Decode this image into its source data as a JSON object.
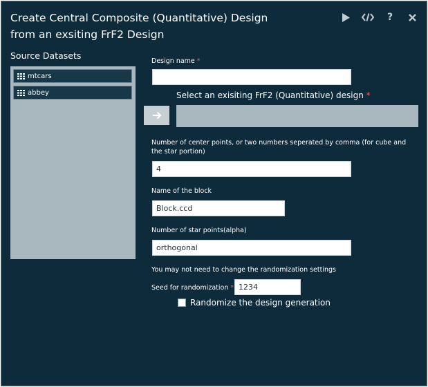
{
  "dialog": {
    "title_line1": "Create Central Composite (Quantitative) Design",
    "title_line2": "from an exsiting FrF2 Design",
    "toolbar": [
      "run-icon",
      "code-icon",
      "help-icon",
      "close-icon"
    ]
  },
  "source": {
    "label": "Source Datasets",
    "datasets": [
      {
        "name": "mtcars"
      },
      {
        "name": "abbey"
      }
    ]
  },
  "form": {
    "design_name_label": "Design name",
    "design_name_value": "",
    "required_mark": "*",
    "select_design_label": "Select an exisiting FrF2 (Quantitative) design",
    "center_points_label": "Number of center points, or two numbers seperated by comma (for cube and the star portion)",
    "center_points_value": "4",
    "block_label": "Name of the block",
    "block_value": "Block.ccd",
    "star_points_label": "Number of star points(alpha)",
    "star_points_value": "orthogonal",
    "randomization_note": "You may not need to change the randomization settings",
    "seed_label": "Seed for randomization",
    "seed_value": "1234",
    "randomize_label": "Randomize the design generation",
    "randomize_checked": false
  },
  "colors": {
    "background": "#0d2b3b",
    "panel": "#a9b8bf",
    "required": "#e06666"
  }
}
